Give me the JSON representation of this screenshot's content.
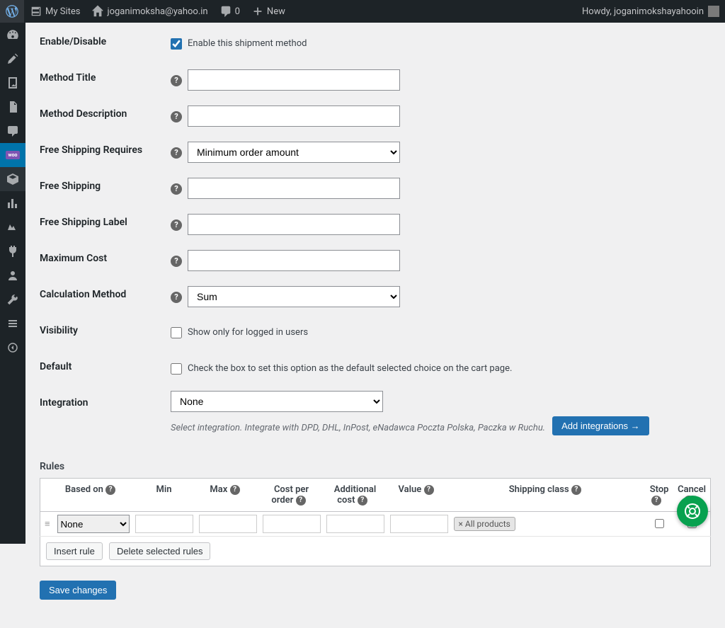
{
  "adminbar": {
    "my_sites": "My Sites",
    "site_name": "joganimoksha@yahoo.in",
    "comments_count": "0",
    "new_label": "New",
    "howdy": "Howdy, joganimokshayahooin"
  },
  "fields": {
    "enable": {
      "label": "Enable/Disable",
      "checkbox_label": "Enable this shipment method",
      "checked": true
    },
    "method_title": {
      "label": "Method Title",
      "value": ""
    },
    "method_desc": {
      "label": "Method Description",
      "value": ""
    },
    "free_requires": {
      "label": "Free Shipping Requires",
      "value": "Minimum order amount"
    },
    "free_shipping": {
      "label": "Free Shipping",
      "value": ""
    },
    "free_shipping_label": {
      "label": "Free Shipping Label",
      "value": ""
    },
    "max_cost": {
      "label": "Maximum Cost",
      "value": ""
    },
    "calc_method": {
      "label": "Calculation Method",
      "value": "Sum"
    },
    "visibility": {
      "label": "Visibility",
      "checkbox_label": "Show only for logged in users",
      "checked": false
    },
    "default": {
      "label": "Default",
      "checkbox_label": "Check the box to set this option as the default selected choice on the cart page.",
      "checked": false
    },
    "integration": {
      "label": "Integration",
      "value": "None",
      "note": "Select integration. Integrate with DPD, DHL, InPost, eNadawca Poczta Polska, Paczka w Ruchu.",
      "button": "Add integrations →"
    }
  },
  "rules": {
    "heading": "Rules",
    "columns": {
      "based_on": "Based on",
      "min": "Min",
      "max": "Max",
      "cost_per_order": "Cost per order",
      "additional_cost": "Additional cost",
      "value": "Value",
      "shipping_class": "Shipping class",
      "stop": "Stop",
      "cancel": "Cancel"
    },
    "row": {
      "based_on": "None",
      "shipping_tag": "× All products"
    },
    "buttons": {
      "insert": "Insert rule",
      "delete": "Delete selected rules"
    }
  },
  "save_button": "Save changes"
}
